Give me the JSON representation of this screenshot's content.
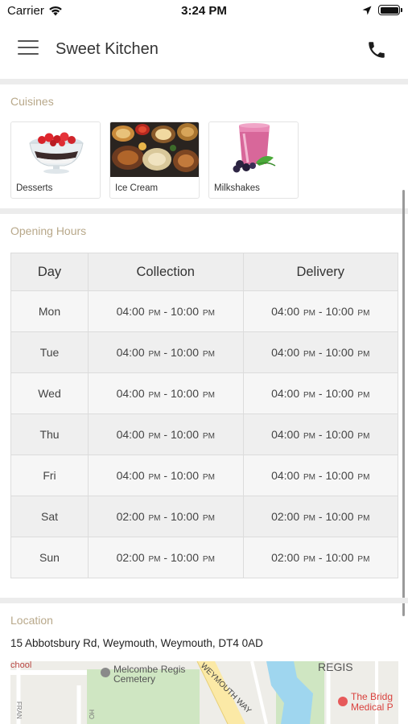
{
  "status_bar": {
    "carrier": "Carrier",
    "time": "3:24 PM"
  },
  "header": {
    "title": "Sweet Kitchen"
  },
  "icons": {
    "menu": "hamburger-icon",
    "phone": "phone-icon",
    "wifi": "wifi-icon",
    "location": "location-arrow-icon",
    "battery": "battery-icon"
  },
  "cuisines": {
    "heading": "Cuisines",
    "items": [
      {
        "label": "Desserts"
      },
      {
        "label": "Ice Cream"
      },
      {
        "label": "Milkshakes"
      }
    ]
  },
  "opening_hours": {
    "heading": "Opening Hours",
    "columns": [
      "Day",
      "Collection",
      "Delivery"
    ],
    "rows": [
      {
        "day": "Mon",
        "collection": {
          "from": "04:00",
          "from_period": "PM",
          "to": "10:00",
          "to_period": "PM"
        },
        "delivery": {
          "from": "04:00",
          "from_period": "PM",
          "to": "10:00",
          "to_period": "PM"
        }
      },
      {
        "day": "Tue",
        "collection": {
          "from": "04:00",
          "from_period": "PM",
          "to": "10:00",
          "to_period": "PM"
        },
        "delivery": {
          "from": "04:00",
          "from_period": "PM",
          "to": "10:00",
          "to_period": "PM"
        }
      },
      {
        "day": "Wed",
        "collection": {
          "from": "04:00",
          "from_period": "PM",
          "to": "10:00",
          "to_period": "PM"
        },
        "delivery": {
          "from": "04:00",
          "from_period": "PM",
          "to": "10:00",
          "to_period": "PM"
        }
      },
      {
        "day": "Thu",
        "collection": {
          "from": "04:00",
          "from_period": "PM",
          "to": "10:00",
          "to_period": "PM"
        },
        "delivery": {
          "from": "04:00",
          "from_period": "PM",
          "to": "10:00",
          "to_period": "PM"
        }
      },
      {
        "day": "Fri",
        "collection": {
          "from": "04:00",
          "from_period": "PM",
          "to": "10:00",
          "to_period": "PM"
        },
        "delivery": {
          "from": "04:00",
          "from_period": "PM",
          "to": "10:00",
          "to_period": "PM"
        }
      },
      {
        "day": "Sat",
        "collection": {
          "from": "02:00",
          "from_period": "PM",
          "to": "10:00",
          "to_period": "PM"
        },
        "delivery": {
          "from": "02:00",
          "from_period": "PM",
          "to": "10:00",
          "to_period": "PM"
        }
      },
      {
        "day": "Sun",
        "collection": {
          "from": "02:00",
          "from_period": "PM",
          "to": "10:00",
          "to_period": "PM"
        },
        "delivery": {
          "from": "02:00",
          "from_period": "PM",
          "to": "10:00",
          "to_period": "PM"
        }
      }
    ]
  },
  "location": {
    "heading": "Location",
    "address": "15 Abbotsbury Rd, Weymouth, Weymouth, DT4 0AD",
    "map_labels": {
      "school": "chool",
      "cemetery_line1": "Melcombe Regis",
      "cemetery_line2": "Cemetery",
      "road": "WEYMOUTH WAY",
      "area": "REGIS",
      "medical_line1": "The Bridg",
      "medical_line2": "Medical P",
      "street_left": "FRAN",
      "street_mid": "HO"
    }
  },
  "colors": {
    "section_heading": "#b8a88a",
    "separator": "#ececec",
    "table_header": "#eeeeee"
  }
}
